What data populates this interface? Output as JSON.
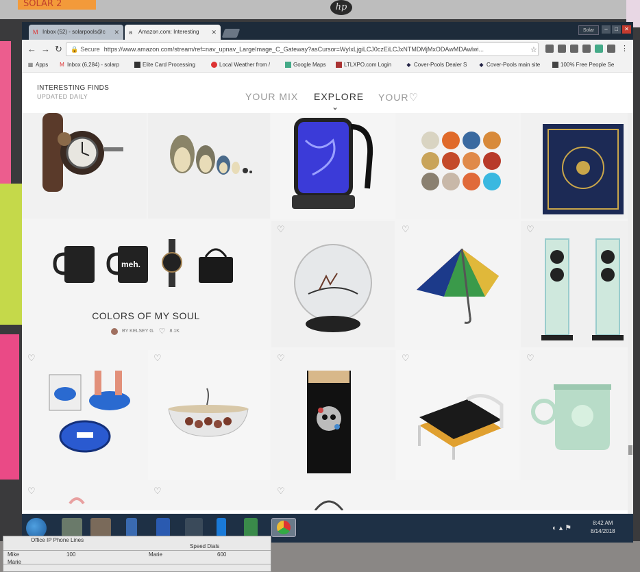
{
  "sticky_note": "SOLAR 2",
  "brand": "hp",
  "browser": {
    "tabs": [
      {
        "label": "Inbox (52) - solarpools@c",
        "icon": "gmail-icon"
      },
      {
        "label": "Amazon.com: Interesting",
        "icon": "amazon-icon"
      }
    ],
    "profile": "Solar",
    "security_label": "Secure",
    "url": "https://www.amazon.com/stream/ref=nav_upnav_LargeImage_C_Gateway?asCursor=WyIxLjgiLCJ0czEiLCJxNTMDMjMxODAwMDAwlwi...",
    "bookmarks": [
      {
        "label": "Apps",
        "icon": "apps-icon"
      },
      {
        "label": "Inbox (6,284) - solarp",
        "icon": "gmail-icon"
      },
      {
        "label": "Elite Card Processing",
        "icon": "card-icon"
      },
      {
        "label": "Local Weather from /",
        "icon": "weather-icon"
      },
      {
        "label": "Google Maps",
        "icon": "maps-icon"
      },
      {
        "label": "LTLXPO.com Login",
        "icon": "truck-icon"
      },
      {
        "label": "Cover-Pools Dealer S",
        "icon": "diamond-icon"
      },
      {
        "label": "Cover-Pools main site",
        "icon": "diamond-icon"
      },
      {
        "label": "100% Free People Se",
        "icon": "people-icon"
      }
    ]
  },
  "page": {
    "title": "INTERESTING FINDS",
    "subtitle": "UPDATED DAILY",
    "nav": [
      {
        "label": "YOUR MIX",
        "active": false
      },
      {
        "label": "EXPLORE",
        "active": true
      },
      {
        "label": "YOUR",
        "active": false,
        "icon": "heart-icon"
      }
    ]
  },
  "collection": {
    "title": "COLORS OF MY SOUL",
    "author": "BY KELSEY G.",
    "likes": "8.1K",
    "mug_text": "meh."
  },
  "taskbar": {
    "time": "8:42 AM",
    "date": "8/14/2018"
  },
  "paper": {
    "title": "Office IP Phone Lines",
    "speed_dials": "Speed Dials",
    "rows": [
      {
        "name": "Mike",
        "ext": "100",
        "dial_name": "Marie",
        "dial_num": "600"
      },
      {
        "name": "Marie",
        "ext": "",
        "dial_name": "",
        "dial_num": ""
      }
    ]
  }
}
